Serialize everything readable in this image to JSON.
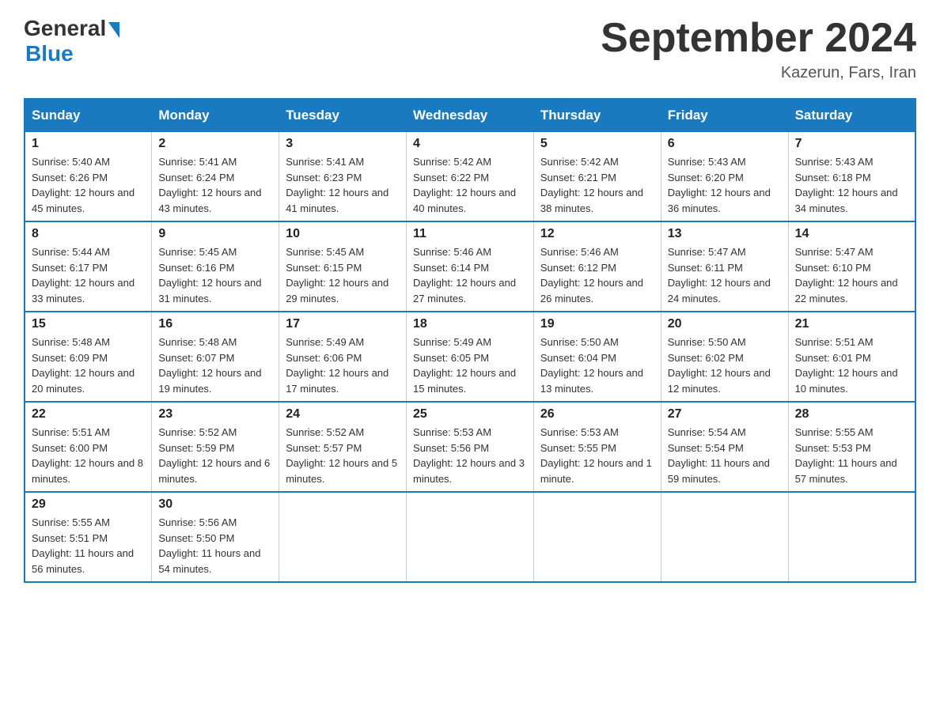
{
  "header": {
    "logo_general": "General",
    "logo_blue": "Blue",
    "title": "September 2024",
    "location": "Kazerun, Fars, Iran"
  },
  "days_of_week": [
    "Sunday",
    "Monday",
    "Tuesday",
    "Wednesday",
    "Thursday",
    "Friday",
    "Saturday"
  ],
  "weeks": [
    [
      {
        "day": "1",
        "sunrise": "Sunrise: 5:40 AM",
        "sunset": "Sunset: 6:26 PM",
        "daylight": "Daylight: 12 hours and 45 minutes."
      },
      {
        "day": "2",
        "sunrise": "Sunrise: 5:41 AM",
        "sunset": "Sunset: 6:24 PM",
        "daylight": "Daylight: 12 hours and 43 minutes."
      },
      {
        "day": "3",
        "sunrise": "Sunrise: 5:41 AM",
        "sunset": "Sunset: 6:23 PM",
        "daylight": "Daylight: 12 hours and 41 minutes."
      },
      {
        "day": "4",
        "sunrise": "Sunrise: 5:42 AM",
        "sunset": "Sunset: 6:22 PM",
        "daylight": "Daylight: 12 hours and 40 minutes."
      },
      {
        "day": "5",
        "sunrise": "Sunrise: 5:42 AM",
        "sunset": "Sunset: 6:21 PM",
        "daylight": "Daylight: 12 hours and 38 minutes."
      },
      {
        "day": "6",
        "sunrise": "Sunrise: 5:43 AM",
        "sunset": "Sunset: 6:20 PM",
        "daylight": "Daylight: 12 hours and 36 minutes."
      },
      {
        "day": "7",
        "sunrise": "Sunrise: 5:43 AM",
        "sunset": "Sunset: 6:18 PM",
        "daylight": "Daylight: 12 hours and 34 minutes."
      }
    ],
    [
      {
        "day": "8",
        "sunrise": "Sunrise: 5:44 AM",
        "sunset": "Sunset: 6:17 PM",
        "daylight": "Daylight: 12 hours and 33 minutes."
      },
      {
        "day": "9",
        "sunrise": "Sunrise: 5:45 AM",
        "sunset": "Sunset: 6:16 PM",
        "daylight": "Daylight: 12 hours and 31 minutes."
      },
      {
        "day": "10",
        "sunrise": "Sunrise: 5:45 AM",
        "sunset": "Sunset: 6:15 PM",
        "daylight": "Daylight: 12 hours and 29 minutes."
      },
      {
        "day": "11",
        "sunrise": "Sunrise: 5:46 AM",
        "sunset": "Sunset: 6:14 PM",
        "daylight": "Daylight: 12 hours and 27 minutes."
      },
      {
        "day": "12",
        "sunrise": "Sunrise: 5:46 AM",
        "sunset": "Sunset: 6:12 PM",
        "daylight": "Daylight: 12 hours and 26 minutes."
      },
      {
        "day": "13",
        "sunrise": "Sunrise: 5:47 AM",
        "sunset": "Sunset: 6:11 PM",
        "daylight": "Daylight: 12 hours and 24 minutes."
      },
      {
        "day": "14",
        "sunrise": "Sunrise: 5:47 AM",
        "sunset": "Sunset: 6:10 PM",
        "daylight": "Daylight: 12 hours and 22 minutes."
      }
    ],
    [
      {
        "day": "15",
        "sunrise": "Sunrise: 5:48 AM",
        "sunset": "Sunset: 6:09 PM",
        "daylight": "Daylight: 12 hours and 20 minutes."
      },
      {
        "day": "16",
        "sunrise": "Sunrise: 5:48 AM",
        "sunset": "Sunset: 6:07 PM",
        "daylight": "Daylight: 12 hours and 19 minutes."
      },
      {
        "day": "17",
        "sunrise": "Sunrise: 5:49 AM",
        "sunset": "Sunset: 6:06 PM",
        "daylight": "Daylight: 12 hours and 17 minutes."
      },
      {
        "day": "18",
        "sunrise": "Sunrise: 5:49 AM",
        "sunset": "Sunset: 6:05 PM",
        "daylight": "Daylight: 12 hours and 15 minutes."
      },
      {
        "day": "19",
        "sunrise": "Sunrise: 5:50 AM",
        "sunset": "Sunset: 6:04 PM",
        "daylight": "Daylight: 12 hours and 13 minutes."
      },
      {
        "day": "20",
        "sunrise": "Sunrise: 5:50 AM",
        "sunset": "Sunset: 6:02 PM",
        "daylight": "Daylight: 12 hours and 12 minutes."
      },
      {
        "day": "21",
        "sunrise": "Sunrise: 5:51 AM",
        "sunset": "Sunset: 6:01 PM",
        "daylight": "Daylight: 12 hours and 10 minutes."
      }
    ],
    [
      {
        "day": "22",
        "sunrise": "Sunrise: 5:51 AM",
        "sunset": "Sunset: 6:00 PM",
        "daylight": "Daylight: 12 hours and 8 minutes."
      },
      {
        "day": "23",
        "sunrise": "Sunrise: 5:52 AM",
        "sunset": "Sunset: 5:59 PM",
        "daylight": "Daylight: 12 hours and 6 minutes."
      },
      {
        "day": "24",
        "sunrise": "Sunrise: 5:52 AM",
        "sunset": "Sunset: 5:57 PM",
        "daylight": "Daylight: 12 hours and 5 minutes."
      },
      {
        "day": "25",
        "sunrise": "Sunrise: 5:53 AM",
        "sunset": "Sunset: 5:56 PM",
        "daylight": "Daylight: 12 hours and 3 minutes."
      },
      {
        "day": "26",
        "sunrise": "Sunrise: 5:53 AM",
        "sunset": "Sunset: 5:55 PM",
        "daylight": "Daylight: 12 hours and 1 minute."
      },
      {
        "day": "27",
        "sunrise": "Sunrise: 5:54 AM",
        "sunset": "Sunset: 5:54 PM",
        "daylight": "Daylight: 11 hours and 59 minutes."
      },
      {
        "day": "28",
        "sunrise": "Sunrise: 5:55 AM",
        "sunset": "Sunset: 5:53 PM",
        "daylight": "Daylight: 11 hours and 57 minutes."
      }
    ],
    [
      {
        "day": "29",
        "sunrise": "Sunrise: 5:55 AM",
        "sunset": "Sunset: 5:51 PM",
        "daylight": "Daylight: 11 hours and 56 minutes."
      },
      {
        "day": "30",
        "sunrise": "Sunrise: 5:56 AM",
        "sunset": "Sunset: 5:50 PM",
        "daylight": "Daylight: 11 hours and 54 minutes."
      },
      null,
      null,
      null,
      null,
      null
    ]
  ]
}
